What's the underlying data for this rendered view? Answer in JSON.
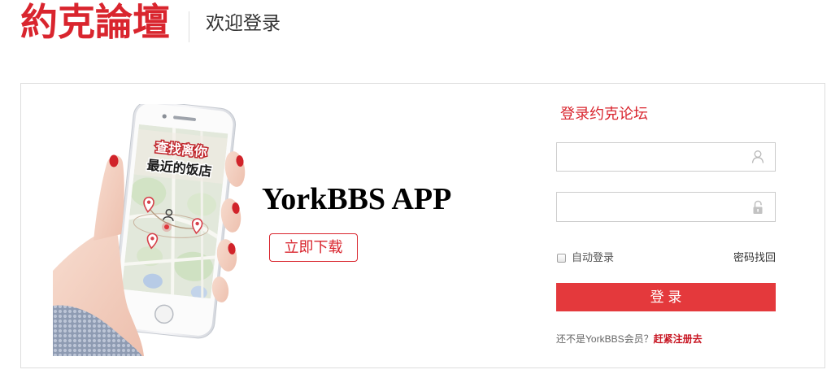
{
  "header": {
    "logo_text": "約克論壇",
    "welcome_text": "欢迎登录"
  },
  "promo": {
    "phone_screen": {
      "banner_line1": "查找离你",
      "banner_line2": "最近的饭店"
    },
    "app_title": "YorkBBS APP",
    "download_label": "立即下载"
  },
  "login_form": {
    "title": "登录约克论坛",
    "username_field": {
      "icon": "user-icon"
    },
    "password_field": {
      "icon": "lock-icon"
    },
    "remember_me": {
      "label": "自动登录",
      "checked": false
    },
    "forgot_password_label": "密码找回",
    "submit_label": "登 录",
    "register": {
      "prompt": "还不是YorkBBS会员？",
      "link_label": "赶紧注册去"
    }
  },
  "colors": {
    "brand_red": "#d9252e",
    "button_red": "#e4393c",
    "link_red": "#c81623",
    "border_gray": "#dddddd"
  }
}
